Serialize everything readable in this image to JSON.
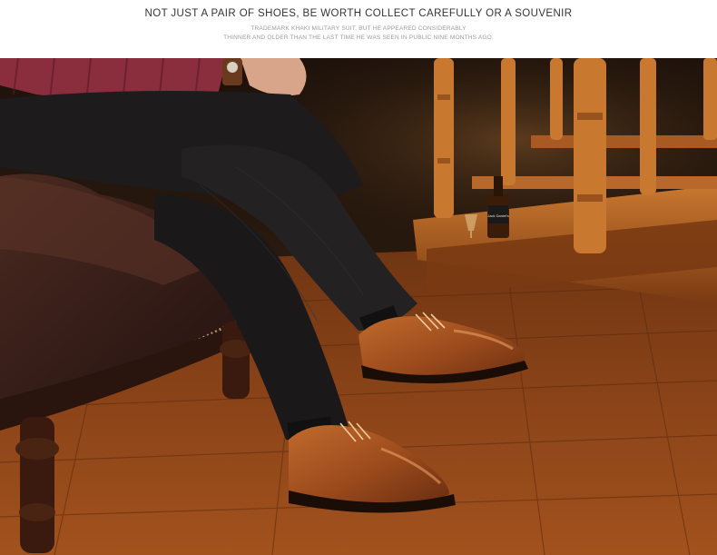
{
  "header": {
    "headline": "NOT JUST A PAIR OF SHOES, BE WORTH COLLECT CAREFULLY OR A SOUVENIR",
    "subline_1": "TRADEMARK KHAKI MILITARY SUIT, BUT HE APPEARED CONSIDERABLY",
    "subline_2": "THINNER AND OLDER THAN THE LAST TIME HE WAS SEEN IN PUBLIC NINE MONTHS AGO."
  },
  "photo": {
    "bottle_label": "Jack Daniel's"
  },
  "colors": {
    "floor": "#8a4318",
    "floor_dark": "#5a2a0e",
    "wall": "#2a1a10",
    "leather_chair": "#3a1e16",
    "trousers": "#1d1b1c",
    "shoe": "#9b4a1c",
    "shirt": "#8a2e3e",
    "stair_wood": "#b9621f"
  }
}
